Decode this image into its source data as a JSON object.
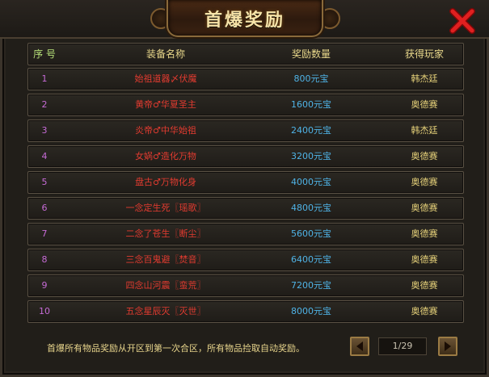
{
  "dialog": {
    "title": "首爆奖励"
  },
  "table": {
    "headers": [
      "序 号",
      "装备名称",
      "奖励数量",
      "获得玩家"
    ],
    "rows": [
      {
        "no": "1",
        "item": "始祖道器〆伏魔",
        "reward": "800元宝",
        "player": "韩杰廷"
      },
      {
        "no": "2",
        "item": "黄帝♂华夏圣主",
        "reward": "1600元宝",
        "player": "奥德赛"
      },
      {
        "no": "3",
        "item": "炎帝♂中华始祖",
        "reward": "2400元宝",
        "player": "韩杰廷"
      },
      {
        "no": "4",
        "item": "女娲♂造化万物",
        "reward": "3200元宝",
        "player": "奥德赛"
      },
      {
        "no": "5",
        "item": "盘古♂万物化身",
        "reward": "4000元宝",
        "player": "奥德赛"
      },
      {
        "no": "6",
        "item": "一念定生死〖瑶歌〗",
        "reward": "4800元宝",
        "player": "奥德赛"
      },
      {
        "no": "7",
        "item": "二念了苍生〖断尘〗",
        "reward": "5600元宝",
        "player": "奥德赛"
      },
      {
        "no": "8",
        "item": "三念百鬼避〖焚音〗",
        "reward": "6400元宝",
        "player": "奥德赛"
      },
      {
        "no": "9",
        "item": "四念山河震〖蛮荒〗",
        "reward": "7200元宝",
        "player": "奥德赛"
      },
      {
        "no": "10",
        "item": "五念星辰灭〖灭世〗",
        "reward": "8000元宝",
        "player": "奥德赛"
      }
    ]
  },
  "footer": {
    "note": "首爆所有物品奖励从开区到第一次合区，所有物品捡取自动奖励。"
  },
  "pager": {
    "page": "1/29",
    "prev_icon": "arrow-left-icon",
    "next_icon": "arrow-right-icon"
  },
  "icons": {
    "close": "close-x-icon"
  },
  "colors": {
    "item_text": "#e23b30",
    "reward_text": "#4fb3e6",
    "player_text": "#e7d27a",
    "number_text": "#c66bd6",
    "close_x": "#d11a1a"
  }
}
